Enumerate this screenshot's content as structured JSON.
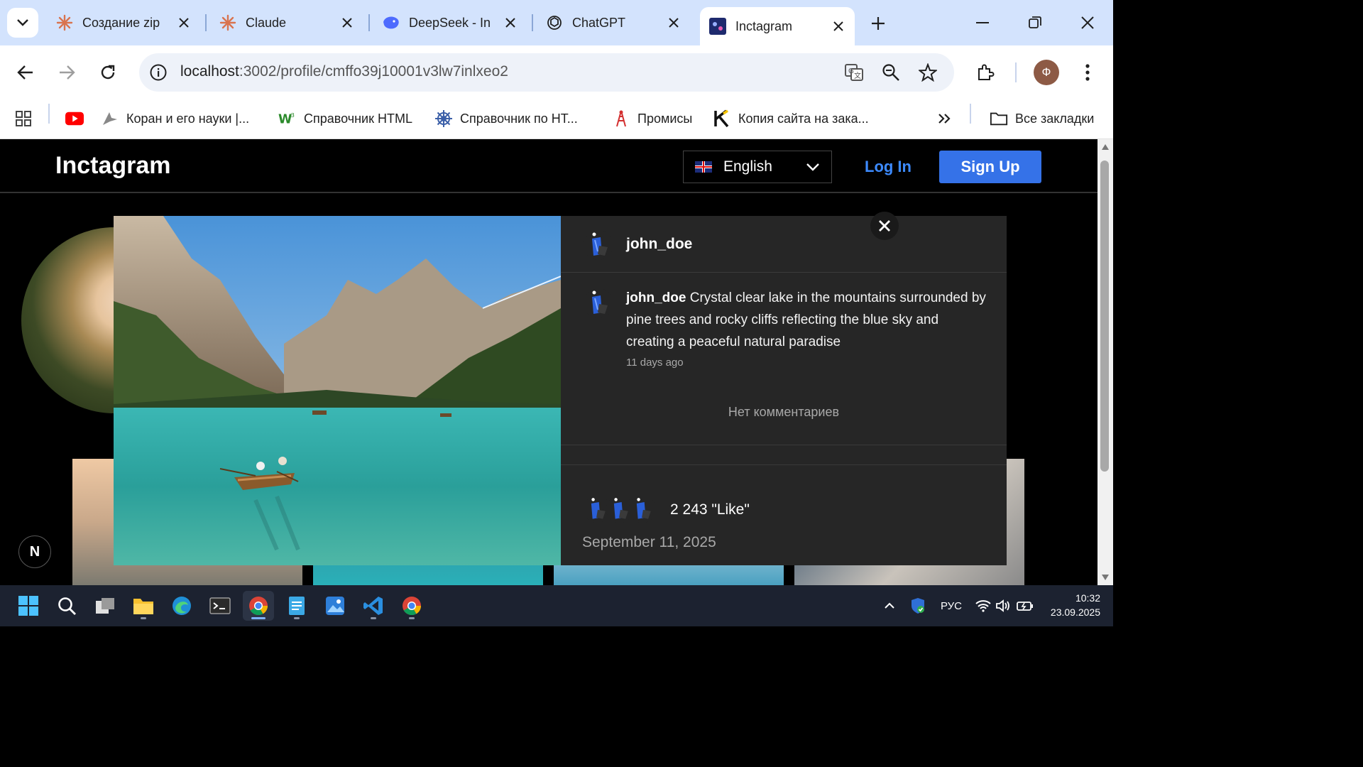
{
  "browser": {
    "tabs": [
      {
        "title": "Создание zip",
        "active": false
      },
      {
        "title": "Claude",
        "active": false
      },
      {
        "title": "DeepSeek - In",
        "active": false
      },
      {
        "title": "ChatGPT",
        "active": false
      },
      {
        "title": "Inctagram",
        "active": true
      }
    ],
    "url_host": "localhost",
    "url_path": ":3002/profile/cmffo39j10001v3lw7inlxeo2",
    "profile_initial": "Ф",
    "bookmarks": [
      {
        "label": ""
      },
      {
        "label": "Коран и его науки |..."
      },
      {
        "label": "Справочник HTML"
      },
      {
        "label": "Справочник по НТ..."
      },
      {
        "label": "Промисы"
      },
      {
        "label": "Копия сайта на зака..."
      }
    ],
    "all_bookmarks": "Все закладки"
  },
  "site": {
    "logo": "Inctagram",
    "language": "English",
    "login": "Log In",
    "signup": "Sign Up",
    "next_badge": "N"
  },
  "post": {
    "author": "john_doe",
    "caption_author": "john_doe",
    "caption": "Crystal clear lake in the mountains surrounded by pine trees and rocky cliffs reflecting the blue sky and creating a peaceful natural paradise",
    "time_ago": "11 days ago",
    "no_comments": "Нет комментариев",
    "likes": "2 243 \"Like\"",
    "date": "September 11, 2025"
  },
  "taskbar": {
    "lang": "РУС",
    "time": "10:32",
    "date": "23.09.2025"
  },
  "colors": {
    "accent_blue": "#3572e8",
    "link_blue": "#3d8bff",
    "modal_bg": "#262626",
    "chrome_tabbar": "#d3e3fd"
  }
}
